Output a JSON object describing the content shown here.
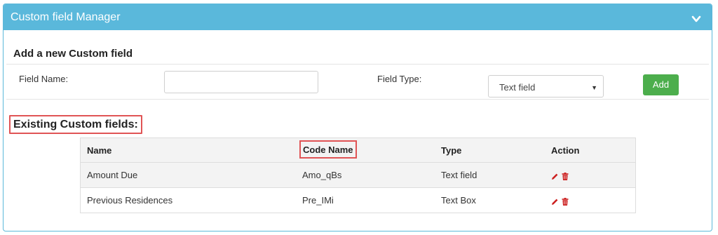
{
  "panel": {
    "title": "Custom field Manager"
  },
  "add_section": {
    "title": "Add a new Custom field",
    "field_name_label": "Field Name:",
    "field_name_value": "",
    "field_type_label": "Field Type:",
    "field_type_selected": "Text field",
    "add_button": "Add"
  },
  "existing": {
    "title": "Existing Custom fields:",
    "columns": [
      "Name",
      "Code Name",
      "Type",
      "Action"
    ],
    "rows": [
      {
        "name": "Amount Due",
        "code": "Amo_qBs",
        "type": "Text field"
      },
      {
        "name": "Previous Residences",
        "code": "Pre_IMi",
        "type": "Text Box"
      }
    ]
  },
  "colors": {
    "header": "#5ab8db",
    "add_button": "#4cae4c",
    "highlight": "#e05455",
    "action_icons": "#cc1f1f"
  }
}
